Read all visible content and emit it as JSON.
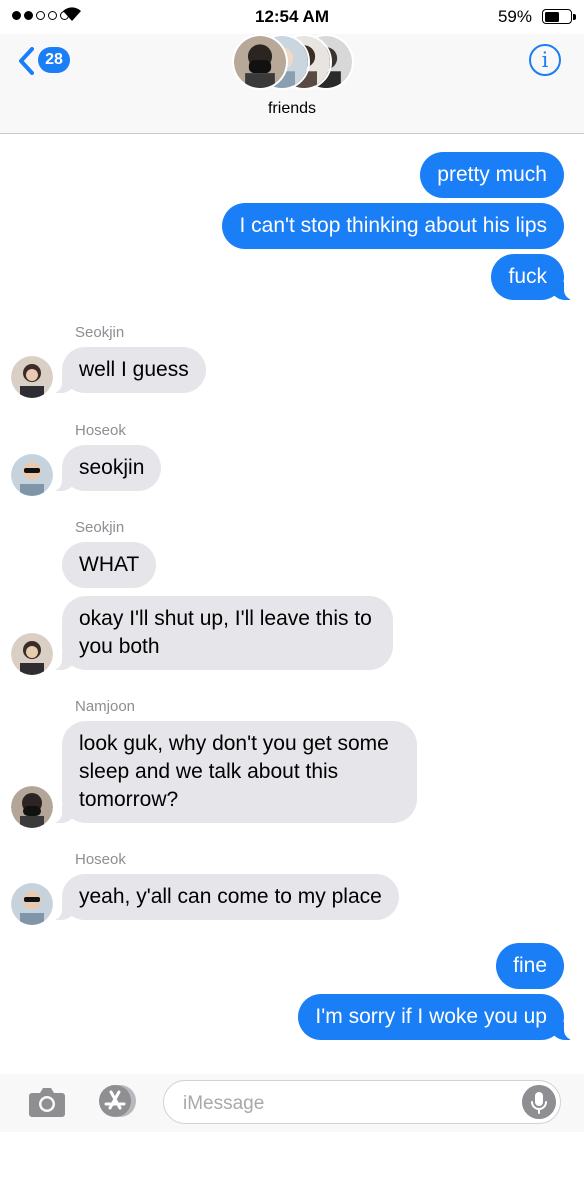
{
  "status": {
    "time": "12:54 AM",
    "battery": "59%",
    "battery_level": 0.59
  },
  "header": {
    "back_count": "28",
    "group_name": "friends",
    "info_label": "i"
  },
  "messages": {
    "m1": "pretty much",
    "m2": "I can't stop thinking about his lips",
    "m3": "fuck",
    "s1": "Seokjin",
    "m4": "well I guess",
    "s2": "Hoseok",
    "m5": "seokjin",
    "s3": "Seokjin",
    "m6": "WHAT",
    "m7a": "okay I'll shut up, I'll leave this to",
    "m7b": "you both",
    "s4": "Namjoon",
    "m8a": "look guk, why don't you get some",
    "m8b": "sleep and we talk about this",
    "m8c": "tomorrow?",
    "s5": "Hoseok",
    "m9": "yeah, y'all can come to my place",
    "m10": "fine",
    "m11": "I'm sorry if I woke you up"
  },
  "input": {
    "placeholder": "iMessage"
  }
}
